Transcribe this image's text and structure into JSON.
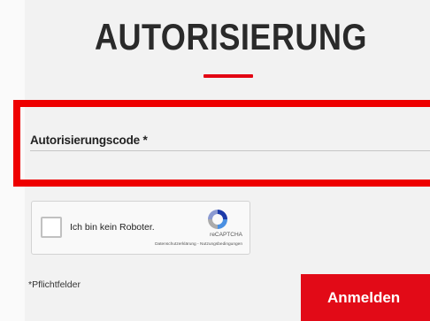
{
  "page": {
    "title": "AUTORISIERUNG"
  },
  "form": {
    "code_label": "Autorisierungscode *",
    "required_note": "*Pflichtfelder",
    "submit_label": "Anmelden"
  },
  "captcha": {
    "label": "Ich bin kein Roboter.",
    "brand": "reCAPTCHA",
    "links": "Datenschutzerklärung - Nutzungsbedingungen"
  },
  "colors": {
    "accent": "#e20a17",
    "highlight": "#ee0000",
    "text": "#222222",
    "background": "#f2f2f2"
  },
  "icons": {
    "captcha_logo": "recaptcha-logo-icon"
  }
}
